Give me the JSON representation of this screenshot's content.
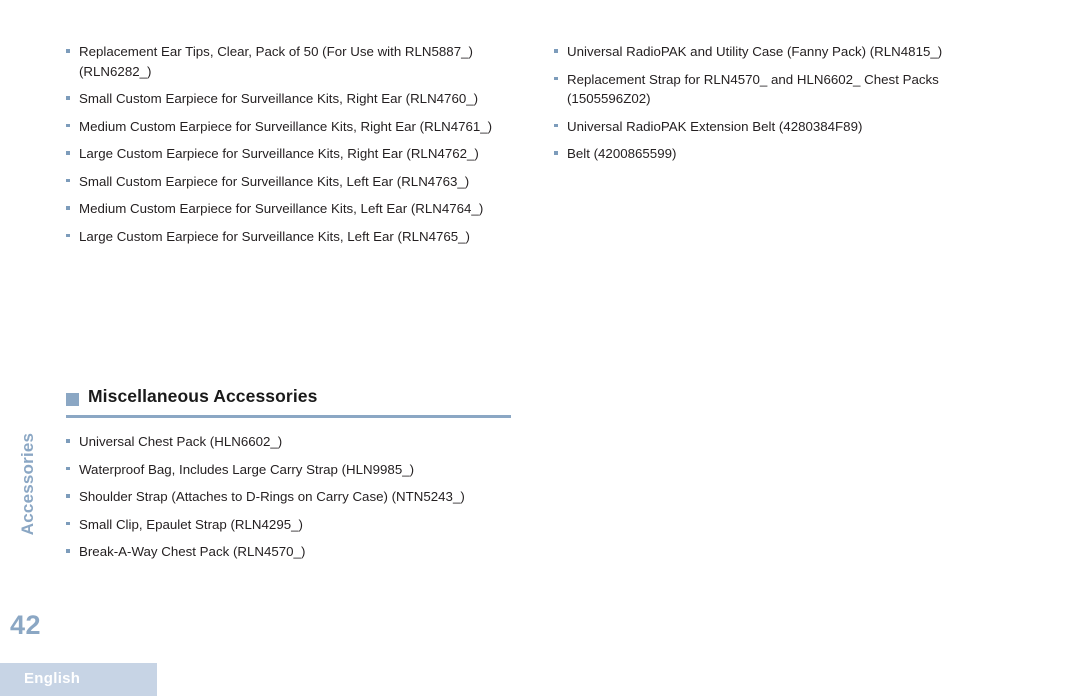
{
  "document": {
    "section_tab_label": "Accessories",
    "page_number": "42",
    "language_label": "English"
  },
  "colors": {
    "accent_blue_gray": "#8ba7c4",
    "bullet_blue": "#7d9cbb",
    "language_bar_bg": "#c7d4e5",
    "body_text": "#231f20",
    "heading_text": "#1a1a1a",
    "page_background": "#ffffff"
  },
  "left_column": {
    "items": [
      "Replacement Ear Tips, Clear, Pack of 50 (For Use with RLN5887_) (RLN6282_)",
      "Small Custom Earpiece for Surveillance Kits, Right Ear (RLN4760_)",
      "Medium Custom Earpiece for Surveillance Kits, Right Ear (RLN4761_)",
      "Large Custom Earpiece for Surveillance Kits, Right Ear (RLN4762_)",
      "Small Custom Earpiece for Surveillance Kits, Left Ear (RLN4763_)",
      "Medium Custom Earpiece for Surveillance Kits, Left Ear (RLN4764_)",
      "Large Custom Earpiece for Surveillance Kits, Left Ear (RLN4765_)"
    ]
  },
  "right_column": {
    "items": [
      "Universal RadioPAK and Utility Case (Fanny Pack) (RLN4815_)",
      "Replacement Strap for RLN4570_ and HLN6602_ Chest Packs (1505596Z02)",
      "Universal RadioPAK Extension Belt (4280384F89)",
      "Belt (4200865599)"
    ]
  },
  "section": {
    "title": "Miscellaneous Accessories",
    "items": [
      "Universal Chest Pack (HLN6602_)",
      "Waterproof Bag, Includes Large Carry Strap (HLN9985_)",
      "Shoulder Strap (Attaches to D-Rings on Carry Case) (NTN5243_)",
      "Small Clip, Epaulet Strap (RLN4295_)",
      "Break-A-Way Chest Pack (RLN4570_)"
    ]
  }
}
